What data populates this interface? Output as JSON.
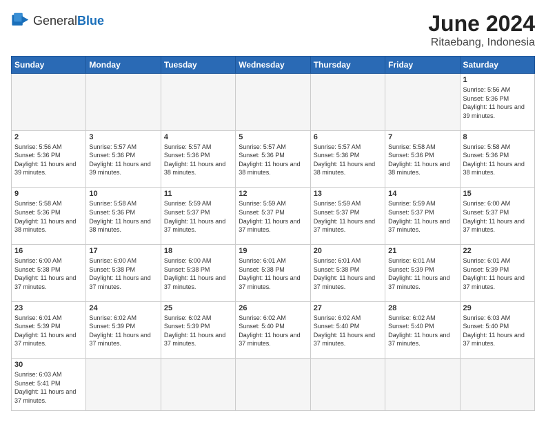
{
  "logo": {
    "text_general": "General",
    "text_blue": "Blue"
  },
  "title": "June 2024",
  "subtitle": "Ritaebang, Indonesia",
  "weekdays": [
    "Sunday",
    "Monday",
    "Tuesday",
    "Wednesday",
    "Thursday",
    "Friday",
    "Saturday"
  ],
  "weeks": [
    [
      {
        "day": "",
        "info": ""
      },
      {
        "day": "",
        "info": ""
      },
      {
        "day": "",
        "info": ""
      },
      {
        "day": "",
        "info": ""
      },
      {
        "day": "",
        "info": ""
      },
      {
        "day": "",
        "info": ""
      },
      {
        "day": "1",
        "info": "Sunrise: 5:56 AM\nSunset: 5:36 PM\nDaylight: 11 hours and 39 minutes."
      }
    ],
    [
      {
        "day": "2",
        "info": "Sunrise: 5:56 AM\nSunset: 5:36 PM\nDaylight: 11 hours and 39 minutes."
      },
      {
        "day": "3",
        "info": "Sunrise: 5:57 AM\nSunset: 5:36 PM\nDaylight: 11 hours and 39 minutes."
      },
      {
        "day": "4",
        "info": "Sunrise: 5:57 AM\nSunset: 5:36 PM\nDaylight: 11 hours and 38 minutes."
      },
      {
        "day": "5",
        "info": "Sunrise: 5:57 AM\nSunset: 5:36 PM\nDaylight: 11 hours and 38 minutes."
      },
      {
        "day": "6",
        "info": "Sunrise: 5:57 AM\nSunset: 5:36 PM\nDaylight: 11 hours and 38 minutes."
      },
      {
        "day": "7",
        "info": "Sunrise: 5:58 AM\nSunset: 5:36 PM\nDaylight: 11 hours and 38 minutes."
      },
      {
        "day": "8",
        "info": "Sunrise: 5:58 AM\nSunset: 5:36 PM\nDaylight: 11 hours and 38 minutes."
      }
    ],
    [
      {
        "day": "9",
        "info": "Sunrise: 5:58 AM\nSunset: 5:36 PM\nDaylight: 11 hours and 38 minutes."
      },
      {
        "day": "10",
        "info": "Sunrise: 5:58 AM\nSunset: 5:36 PM\nDaylight: 11 hours and 38 minutes."
      },
      {
        "day": "11",
        "info": "Sunrise: 5:59 AM\nSunset: 5:37 PM\nDaylight: 11 hours and 37 minutes."
      },
      {
        "day": "12",
        "info": "Sunrise: 5:59 AM\nSunset: 5:37 PM\nDaylight: 11 hours and 37 minutes."
      },
      {
        "day": "13",
        "info": "Sunrise: 5:59 AM\nSunset: 5:37 PM\nDaylight: 11 hours and 37 minutes."
      },
      {
        "day": "14",
        "info": "Sunrise: 5:59 AM\nSunset: 5:37 PM\nDaylight: 11 hours and 37 minutes."
      },
      {
        "day": "15",
        "info": "Sunrise: 6:00 AM\nSunset: 5:37 PM\nDaylight: 11 hours and 37 minutes."
      }
    ],
    [
      {
        "day": "16",
        "info": "Sunrise: 6:00 AM\nSunset: 5:38 PM\nDaylight: 11 hours and 37 minutes."
      },
      {
        "day": "17",
        "info": "Sunrise: 6:00 AM\nSunset: 5:38 PM\nDaylight: 11 hours and 37 minutes."
      },
      {
        "day": "18",
        "info": "Sunrise: 6:00 AM\nSunset: 5:38 PM\nDaylight: 11 hours and 37 minutes."
      },
      {
        "day": "19",
        "info": "Sunrise: 6:01 AM\nSunset: 5:38 PM\nDaylight: 11 hours and 37 minutes."
      },
      {
        "day": "20",
        "info": "Sunrise: 6:01 AM\nSunset: 5:38 PM\nDaylight: 11 hours and 37 minutes."
      },
      {
        "day": "21",
        "info": "Sunrise: 6:01 AM\nSunset: 5:39 PM\nDaylight: 11 hours and 37 minutes."
      },
      {
        "day": "22",
        "info": "Sunrise: 6:01 AM\nSunset: 5:39 PM\nDaylight: 11 hours and 37 minutes."
      }
    ],
    [
      {
        "day": "23",
        "info": "Sunrise: 6:01 AM\nSunset: 5:39 PM\nDaylight: 11 hours and 37 minutes."
      },
      {
        "day": "24",
        "info": "Sunrise: 6:02 AM\nSunset: 5:39 PM\nDaylight: 11 hours and 37 minutes."
      },
      {
        "day": "25",
        "info": "Sunrise: 6:02 AM\nSunset: 5:39 PM\nDaylight: 11 hours and 37 minutes."
      },
      {
        "day": "26",
        "info": "Sunrise: 6:02 AM\nSunset: 5:40 PM\nDaylight: 11 hours and 37 minutes."
      },
      {
        "day": "27",
        "info": "Sunrise: 6:02 AM\nSunset: 5:40 PM\nDaylight: 11 hours and 37 minutes."
      },
      {
        "day": "28",
        "info": "Sunrise: 6:02 AM\nSunset: 5:40 PM\nDaylight: 11 hours and 37 minutes."
      },
      {
        "day": "29",
        "info": "Sunrise: 6:03 AM\nSunset: 5:40 PM\nDaylight: 11 hours and 37 minutes."
      }
    ],
    [
      {
        "day": "30",
        "info": "Sunrise: 6:03 AM\nSunset: 5:41 PM\nDaylight: 11 hours and 37 minutes."
      },
      {
        "day": "",
        "info": ""
      },
      {
        "day": "",
        "info": ""
      },
      {
        "day": "",
        "info": ""
      },
      {
        "day": "",
        "info": ""
      },
      {
        "day": "",
        "info": ""
      },
      {
        "day": "",
        "info": ""
      }
    ]
  ]
}
